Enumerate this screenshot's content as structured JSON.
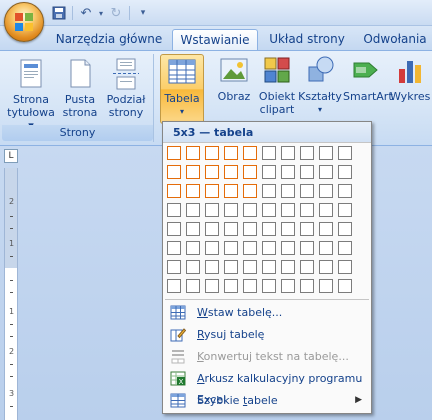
{
  "title_bar": {
    "office_button": "office-orb",
    "qat": [
      "save-icon",
      "undo-icon",
      "redo-icon",
      "customize-icon"
    ]
  },
  "tabs": [
    {
      "label": "Narzędzia główne",
      "active": false
    },
    {
      "label": "Wstawianie",
      "active": true
    },
    {
      "label": "Układ strony",
      "active": false
    },
    {
      "label": "Odwołania",
      "active": false
    }
  ],
  "ribbon": {
    "pages_group": {
      "label": "Strony",
      "cover_page": {
        "line1": "Strona",
        "line2": "tytułowa ▾"
      },
      "blank_page": {
        "line1": "Pusta",
        "line2": "strona"
      },
      "page_break": {
        "line1": "Podział",
        "line2": "strony"
      }
    },
    "table_button": {
      "label": "Tabela",
      "caret": "▾"
    },
    "picture": "Obraz",
    "clipart": {
      "line1": "Obiekt",
      "line2": "clipart"
    },
    "shapes": {
      "line1": "Kształty",
      "caret": "▾"
    },
    "smartart": "SmartArt",
    "chart": "Wykres"
  },
  "ruler": {
    "corner": "L",
    "numbers": [
      "2",
      "1",
      "1",
      "2",
      "3"
    ]
  },
  "dropdown": {
    "header": "5x3 — tabela",
    "grid": {
      "cols": 10,
      "rows": 8,
      "selected_cols": 5,
      "selected_rows": 3
    },
    "items": [
      {
        "pre": "",
        "acc": "W",
        "post": "staw tabelę...",
        "icon": "insert-table-icon",
        "disabled": false
      },
      {
        "pre": "",
        "acc": "R",
        "post": "ysuj tabelę",
        "icon": "draw-table-icon",
        "disabled": false
      },
      {
        "pre": "",
        "acc": "K",
        "post": "onwertuj tekst na tabelę...",
        "icon": "convert-text-icon",
        "disabled": true
      },
      {
        "pre": "",
        "acc": "A",
        "post": "rkusz kalkulacyjny programu Excel",
        "icon": "excel-sheet-icon",
        "disabled": false
      },
      {
        "pre": "Szybkie ",
        "acc": "t",
        "post": "abele",
        "icon": "quick-tables-icon",
        "disabled": false,
        "submenu": "▶"
      }
    ]
  },
  "colors": {
    "accent": "#15428b",
    "highlight": "#e46c0a"
  }
}
